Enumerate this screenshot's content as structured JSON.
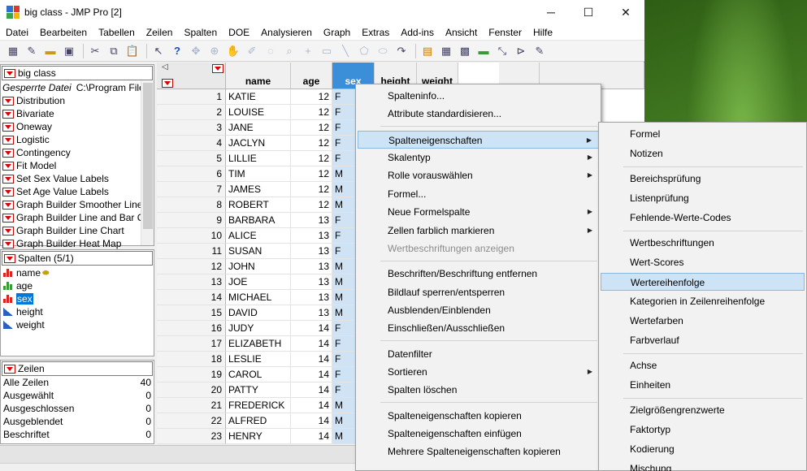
{
  "window": {
    "title": "big class - JMP Pro [2]"
  },
  "window_controls": {
    "minimize": "─",
    "maximize": "☐",
    "close": "✕"
  },
  "menubar": [
    "Datei",
    "Bearbeiten",
    "Tabellen",
    "Zeilen",
    "Spalten",
    "DOE",
    "Analysieren",
    "Graph",
    "Extras",
    "Add-ins",
    "Ansicht",
    "Fenster",
    "Hilfe"
  ],
  "table_panel": {
    "title": "big class",
    "locked_label": "Gesperrte Datei",
    "locked_path": "C:\\Program File",
    "scripts": [
      "Distribution",
      "Bivariate",
      "Oneway",
      "Logistic",
      "Contingency",
      "Fit Model",
      "Set Sex Value Labels",
      "Set Age Value Labels",
      "Graph Builder Smoother Line",
      "Graph Builder Line and Bar Ch",
      "Graph Builder Line Chart",
      "Graph Builder Heat Map"
    ]
  },
  "columns_panel": {
    "title": "Spalten (5/1)",
    "items": [
      {
        "name": "name",
        "type": "nominal",
        "key": true
      },
      {
        "name": "age",
        "type": "ordinal"
      },
      {
        "name": "sex",
        "type": "nominal",
        "selected": true
      },
      {
        "name": "height",
        "type": "continuous"
      },
      {
        "name": "weight",
        "type": "continuous"
      }
    ]
  },
  "rows_panel": {
    "title": "Zeilen",
    "items": [
      {
        "label": "Alle Zeilen",
        "value": "40"
      },
      {
        "label": "Ausgewählt",
        "value": "0"
      },
      {
        "label": "Ausgeschlossen",
        "value": "0"
      },
      {
        "label": "Ausgeblendet",
        "value": "0"
      },
      {
        "label": "Beschriftet",
        "value": "0"
      }
    ]
  },
  "grid": {
    "headers": [
      "name",
      "age",
      "sex",
      "height",
      "weight"
    ],
    "rows": [
      [
        "1",
        "KATIE",
        "12",
        "F"
      ],
      [
        "2",
        "LOUISE",
        "12",
        "F"
      ],
      [
        "3",
        "JANE",
        "12",
        "F"
      ],
      [
        "4",
        "JACLYN",
        "12",
        "F"
      ],
      [
        "5",
        "LILLIE",
        "12",
        "F"
      ],
      [
        "6",
        "TIM",
        "12",
        "M"
      ],
      [
        "7",
        "JAMES",
        "12",
        "M"
      ],
      [
        "8",
        "ROBERT",
        "12",
        "M"
      ],
      [
        "9",
        "BARBARA",
        "13",
        "F"
      ],
      [
        "10",
        "ALICE",
        "13",
        "F"
      ],
      [
        "11",
        "SUSAN",
        "13",
        "F"
      ],
      [
        "12",
        "JOHN",
        "13",
        "M"
      ],
      [
        "13",
        "JOE",
        "13",
        "M"
      ],
      [
        "14",
        "MICHAEL",
        "13",
        "M"
      ],
      [
        "15",
        "DAVID",
        "13",
        "M"
      ],
      [
        "16",
        "JUDY",
        "14",
        "F"
      ],
      [
        "17",
        "ELIZABETH",
        "14",
        "F"
      ],
      [
        "18",
        "LESLIE",
        "14",
        "F"
      ],
      [
        "19",
        "CAROL",
        "14",
        "F"
      ],
      [
        "20",
        "PATTY",
        "14",
        "F"
      ],
      [
        "21",
        "FREDERICK",
        "14",
        "M"
      ],
      [
        "22",
        "ALFRED",
        "14",
        "M"
      ],
      [
        "23",
        "HENRY",
        "14",
        "M"
      ]
    ]
  },
  "context_menu": {
    "items": [
      {
        "label": "Spalteninfo...",
        "sep_after": false
      },
      {
        "label": "Attribute standardisieren...",
        "sep_after": true
      },
      {
        "label": "Spalteneigenschaften",
        "submenu": true,
        "highlight": true
      },
      {
        "label": "Skalentyp",
        "submenu": true
      },
      {
        "label": "Rolle vorauswählen",
        "submenu": true
      },
      {
        "label": "Formel..."
      },
      {
        "label": "Neue Formelspalte",
        "submenu": true
      },
      {
        "label": "Zellen farblich markieren",
        "submenu": true
      },
      {
        "label": "Wertbeschriftungen anzeigen",
        "disabled": true,
        "sep_after": true
      },
      {
        "label": "Beschriften/Beschriftung entfernen"
      },
      {
        "label": "Bildlauf sperren/entsperren"
      },
      {
        "label": "Ausblenden/Einblenden"
      },
      {
        "label": "Einschließen/Ausschließen",
        "sep_after": true
      },
      {
        "label": "Datenfilter"
      },
      {
        "label": "Sortieren",
        "submenu": true
      },
      {
        "label": "Spalten löschen",
        "sep_after": true
      },
      {
        "label": "Spalteneigenschaften kopieren"
      },
      {
        "label": "Spalteneigenschaften einfügen"
      },
      {
        "label": "Mehrere Spalteneigenschaften kopieren"
      }
    ]
  },
  "sub_menu": {
    "items": [
      {
        "label": "Formel"
      },
      {
        "label": "Notizen",
        "sep_after": true
      },
      {
        "label": "Bereichsprüfung"
      },
      {
        "label": "Listenprüfung"
      },
      {
        "label": "Fehlende-Werte-Codes",
        "sep_after": true
      },
      {
        "label": "Wertbeschriftungen"
      },
      {
        "label": "Wert-Scores"
      },
      {
        "label": "Wertereihenfolge",
        "highlight": true
      },
      {
        "label": "Kategorien in Zeilenreihenfolge"
      },
      {
        "label": "Wertefarben"
      },
      {
        "label": "Farbverlauf",
        "sep_after": true
      },
      {
        "label": "Achse"
      },
      {
        "label": "Einheiten",
        "sep_after": true
      },
      {
        "label": "Zielgrößengrenzwerte"
      },
      {
        "label": "Faktortyp"
      },
      {
        "label": "Kodierung"
      },
      {
        "label": "Mischung"
      }
    ]
  }
}
